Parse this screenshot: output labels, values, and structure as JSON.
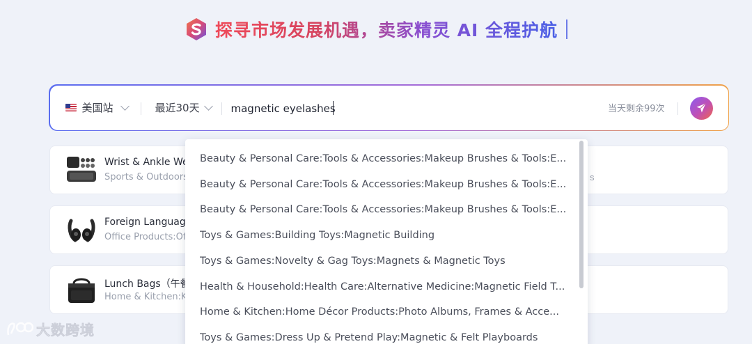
{
  "header": {
    "title": "探寻市场发展机遇，卖家精灵 AI 全程护航",
    "logo_icon": "s-logo-icon"
  },
  "search": {
    "site_label": "美国站",
    "date_label": "最近30天",
    "query_value": "magnetic eyelashes",
    "quota_text": "当天剩余99次",
    "send_icon": "paper-plane-icon"
  },
  "cards": [
    {
      "title": "Wrist & Ankle We",
      "subtitle": "Sports & Outdoors",
      "tail": "s"
    },
    {
      "title": "Foreign Language",
      "subtitle": "Office Products:Ofi",
      "tail": ""
    },
    {
      "title": "Lunch Bags（午餐",
      "subtitle": "Home & Kitchen:K",
      "tail": ""
    }
  ],
  "dropdown": {
    "items": [
      "Beauty & Personal Care:Tools & Accessories:Makeup Brushes & Tools:E...",
      "Beauty & Personal Care:Tools & Accessories:Makeup Brushes & Tools:E...",
      "Beauty & Personal Care:Tools & Accessories:Makeup Brushes & Tools:E...",
      "Toys & Games:Building Toys:Magnetic Building",
      "Toys & Games:Novelty & Gag Toys:Magnets & Magnetic Toys",
      "Health & Household:Health Care:Alternative Medicine:Magnetic Field T...",
      "Home & Kitchen:Home Décor Products:Photo Albums, Frames & Acce...",
      "Toys & Games:Dress Up & Pretend Play:Magnetic & Felt Playboards"
    ]
  },
  "watermark": {
    "text": "大数跨境"
  },
  "colors": {
    "background": "#eff2f9",
    "accent_blue": "#5b6ef0",
    "accent_purple": "#a66cd8",
    "accent_orange": "#f0a24a"
  }
}
